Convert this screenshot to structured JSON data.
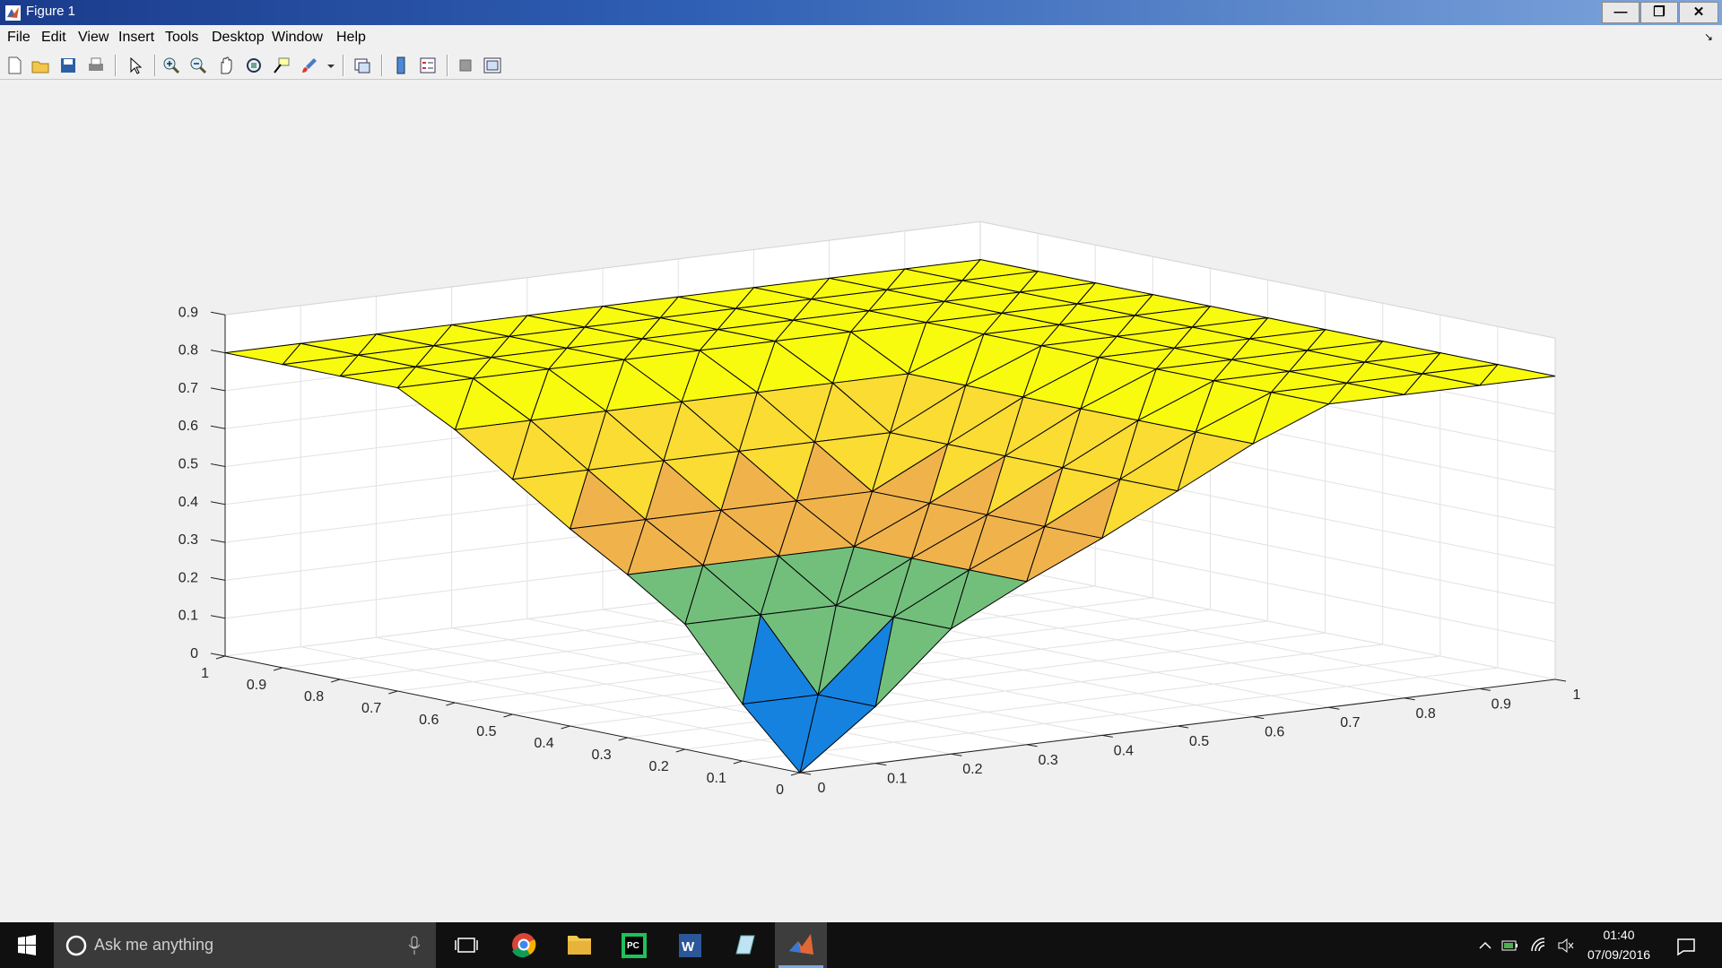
{
  "window": {
    "title": "Figure 1",
    "buttons": {
      "minimize": "—",
      "restore": "❐",
      "close": "✕"
    }
  },
  "menu": {
    "items": [
      "File",
      "Edit",
      "View",
      "Insert",
      "Tools",
      "Desktop",
      "Window",
      "Help"
    ]
  },
  "toolbar": {
    "icons": [
      "new-figure-icon",
      "open-file-icon",
      "save-icon",
      "print-icon",
      "edit-plot-icon",
      "zoom-in-icon",
      "zoom-out-icon",
      "pan-icon",
      "rotate-3d-icon",
      "data-cursor-icon",
      "brush-icon",
      "link-plot-icon",
      "colorbar-icon",
      "legend-icon",
      "hide-plot-tools-icon",
      "show-plot-tools-icon"
    ]
  },
  "chart_data": {
    "type": "surface",
    "x": [
      0,
      0.1,
      0.2,
      0.3,
      0.4,
      0.5,
      0.6,
      0.7,
      0.8,
      0.9,
      1
    ],
    "y": [
      0,
      0.1,
      0.2,
      0.3,
      0.4,
      0.5,
      0.6,
      0.7,
      0.8,
      0.9,
      1
    ],
    "z_description_rule": "near-constant plateau with a cone-shaped well centred near the origin corner",
    "plateau_value": 0.8,
    "well_levels": [
      0.0,
      0.15,
      0.33,
      0.43,
      0.52,
      0.62,
      0.72,
      0.8
    ],
    "xlim": [
      0,
      1
    ],
    "ylim": [
      0,
      1
    ],
    "zlim": [
      0,
      0.9
    ],
    "x_ticks": [
      "0",
      "0.1",
      "0.2",
      "0.3",
      "0.4",
      "0.5",
      "0.6",
      "0.7",
      "0.8",
      "0.9",
      "1"
    ],
    "y_ticks": [
      "0",
      "0.1",
      "0.2",
      "0.3",
      "0.4",
      "0.5",
      "0.6",
      "0.7",
      "0.8",
      "0.9",
      "1"
    ],
    "z_ticks": [
      "0",
      "0.1",
      "0.2",
      "0.3",
      "0.4",
      "0.5",
      "0.6",
      "0.7",
      "0.8",
      "0.9"
    ],
    "grid": true,
    "colormap": [
      "#3e26a8",
      "#1582e0",
      "#72bf7c",
      "#f0b34c",
      "#fadc33",
      "#f9fb0e"
    ]
  },
  "taskbar": {
    "search_placeholder": "Ask me anything",
    "apps": [
      "task-view-icon",
      "chrome-icon",
      "file-explorer-icon",
      "pycharm-icon",
      "word-icon",
      "notepad-icon",
      "matlab-icon"
    ],
    "time": "01:40",
    "date": "07/09/2016"
  }
}
